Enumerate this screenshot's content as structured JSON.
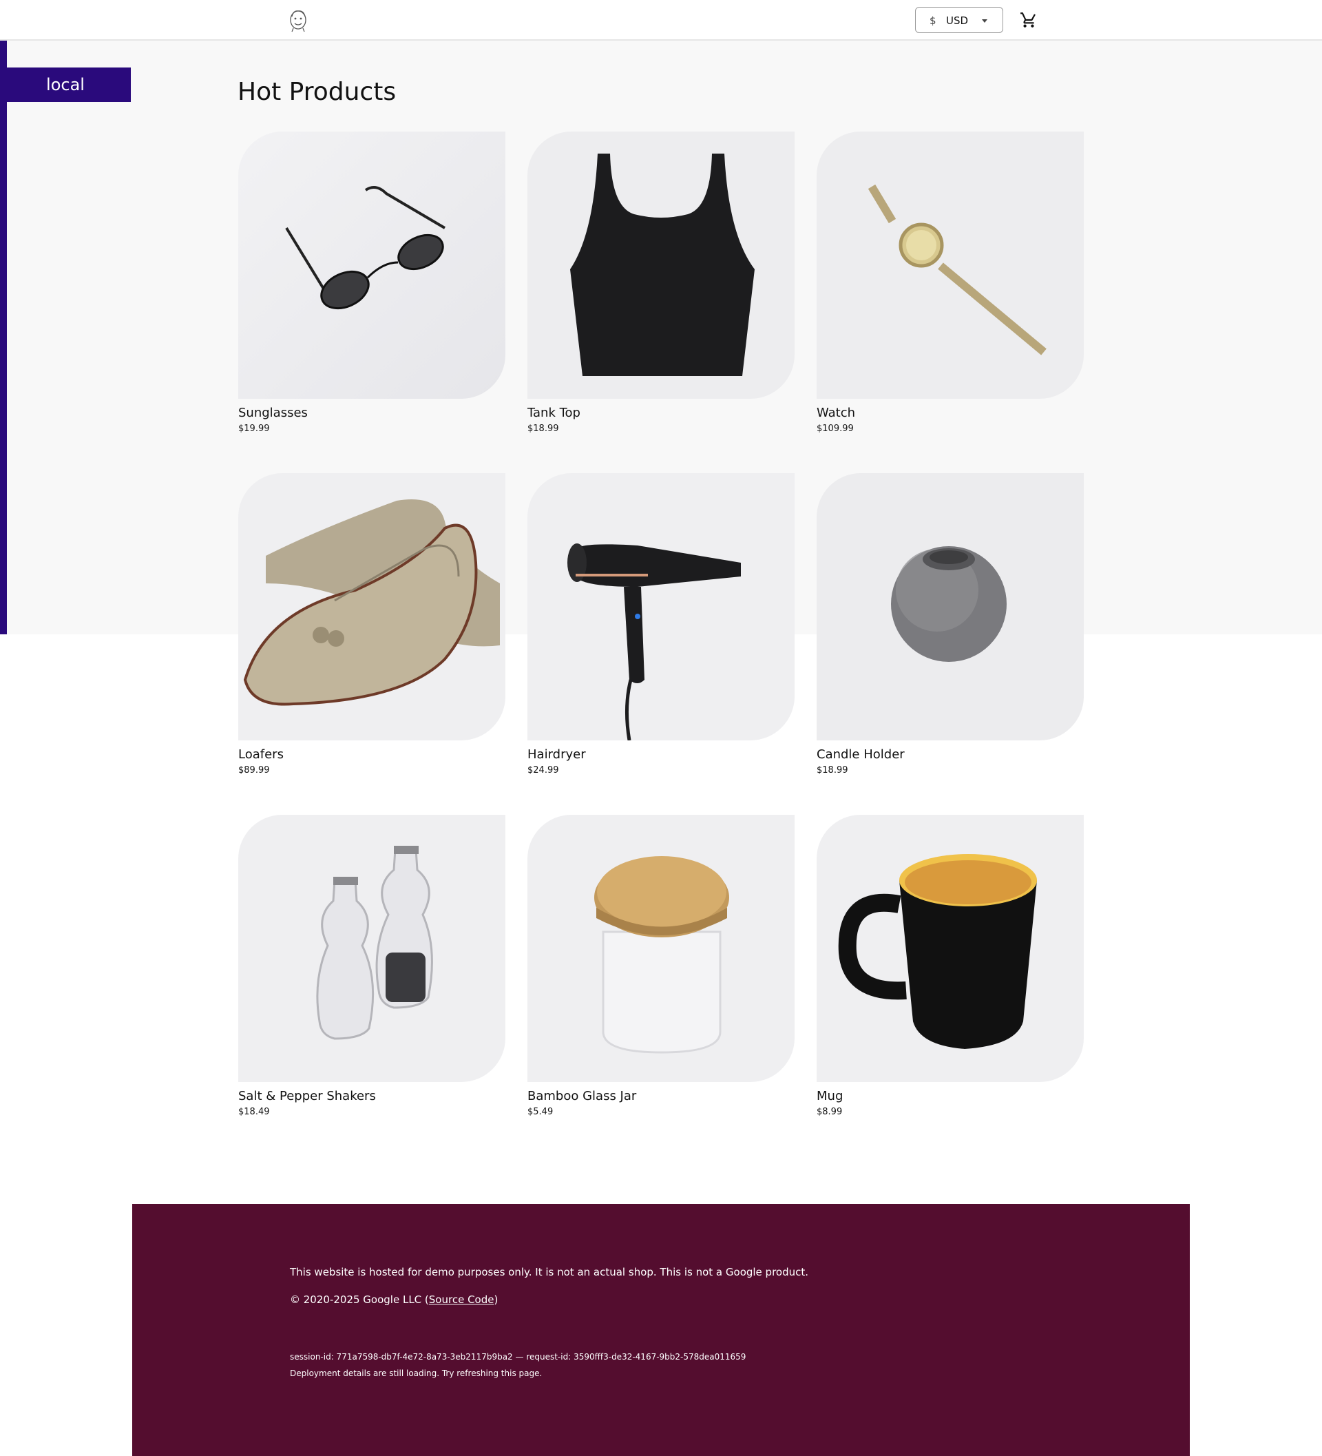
{
  "environment": {
    "label": "local"
  },
  "header": {
    "currency": {
      "symbol": "$",
      "code": "USD"
    }
  },
  "main": {
    "title": "Hot Products",
    "products": [
      {
        "name": "Sunglasses",
        "price": "$19.99"
      },
      {
        "name": "Tank Top",
        "price": "$18.99"
      },
      {
        "name": "Watch",
        "price": "$109.99"
      },
      {
        "name": "Loafers",
        "price": "$89.99"
      },
      {
        "name": "Hairdryer",
        "price": "$24.99"
      },
      {
        "name": "Candle Holder",
        "price": "$18.99"
      },
      {
        "name": "Salt & Pepper Shakers",
        "price": "$18.49"
      },
      {
        "name": "Bamboo Glass Jar",
        "price": "$5.49"
      },
      {
        "name": "Mug",
        "price": "$8.99"
      }
    ]
  },
  "footer": {
    "disclaimer": "This website is hosted for demo purposes only. It is not an actual shop. This is not a Google product.",
    "copyright_prefix": "© 2020-2025 Google LLC (",
    "source_code_link": "Source Code",
    "copyright_suffix": ")",
    "session": "session-id: 771a7598-db7f-4e72-8a73-3eb2117b9ba2 — request-id: 3590fff3-de32-4167-9bb2-578dea011659",
    "deployment": "Deployment details are still loading. Try refreshing this page."
  },
  "colors": {
    "brand_purple": "#2a0a7c",
    "footer_bg": "#540d2f",
    "page_bg": "#f8f8f8"
  },
  "icons": {
    "logo": "boutique-logo-icon",
    "cart": "shopping-cart-icon",
    "caret": "chevron-down-icon"
  }
}
